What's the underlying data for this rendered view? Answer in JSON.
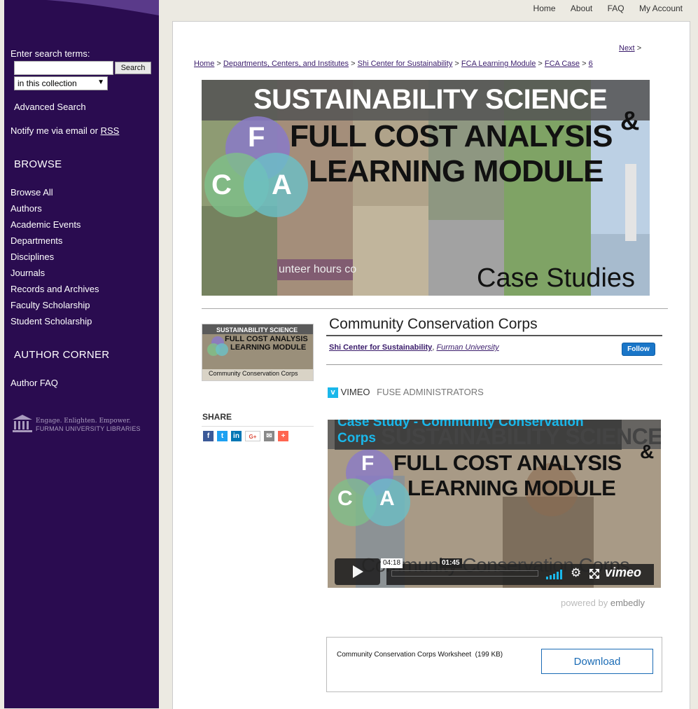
{
  "sidebar": {
    "search_label": "Enter search terms:",
    "search_button": "Search",
    "search_value": "",
    "scope_selected": "in this collection",
    "advanced_search": "Advanced Search",
    "notify_text": "Notify me via email or ",
    "rss": "RSS",
    "browse_heading": "BROWSE",
    "browse_items": [
      "Browse All",
      "Authors",
      "Academic Events",
      "Departments",
      "Disciplines",
      "Journals",
      "Records and Archives",
      "Faculty Scholarship",
      "Student Scholarship"
    ],
    "author_corner_heading": "AUTHOR CORNER",
    "author_faq": "Author FAQ",
    "logo_line1": "Engage. Enlighten. Empower.",
    "logo_line2": "FURMAN UNIVERSITY LIBRARIES"
  },
  "topnav": [
    "Home",
    "About",
    "FAQ",
    "My Account"
  ],
  "pager": {
    "next": "Next",
    "arrow": ">"
  },
  "breadcrumb": {
    "items": [
      "Home",
      "Departments, Centers, and Institutes",
      "Shi Center for Sustainability",
      "FCA Learning Module",
      "FCA Case",
      "6"
    ],
    "separator": ">"
  },
  "banner": {
    "line1": "SUSTAINABILITY SCIENCE",
    "amp": "&",
    "line2": "FULL COST ANALYSIS",
    "line3": "LEARNING MODULE",
    "letters": [
      "F",
      "C",
      "A"
    ],
    "overlay_text": "unteer hours co",
    "subtitle": "Case Studies"
  },
  "thumbnail": {
    "line1": "SUSTAINABILITY SCIENCE",
    "line2": "FULL COST ANALYSIS",
    "line3": "LEARNING MODULE",
    "caption": "Community Conservation Corps"
  },
  "share": {
    "label": "SHARE",
    "icons": [
      "facebook-icon",
      "twitter-icon",
      "linkedin-icon",
      "google-plus-icon",
      "email-icon",
      "addthis-icon"
    ]
  },
  "item": {
    "title": "Community Conservation Corps",
    "publisher": "Shi Center for Sustainability",
    "institution": "Furman University",
    "follow": "Follow"
  },
  "video": {
    "provider": "VIMEO",
    "uploader": "FUSE ADMINISTRATORS",
    "title": "Case Study - Community Conservation Corps",
    "frame_line1": "SUSTAINABILITY SCIENCE",
    "frame_line2": "FULL COST ANALYSIS",
    "frame_line3": "LEARNING MODULE",
    "frame_caption": "Community Conservation Corps",
    "duration": "04:18",
    "hover_time": "01:45",
    "brand": "vimeo",
    "powered_by": "powered by",
    "embedly": "embedly"
  },
  "file": {
    "name": "Community Conservation Corps Worksheet",
    "size": "(199 KB)",
    "download": "Download"
  },
  "colors": {
    "sidebar_bg": "#2a0c50",
    "link": "#3a1c6b",
    "follow_bg": "#1a76c8",
    "vimeo_title": "#1ab7ea"
  }
}
